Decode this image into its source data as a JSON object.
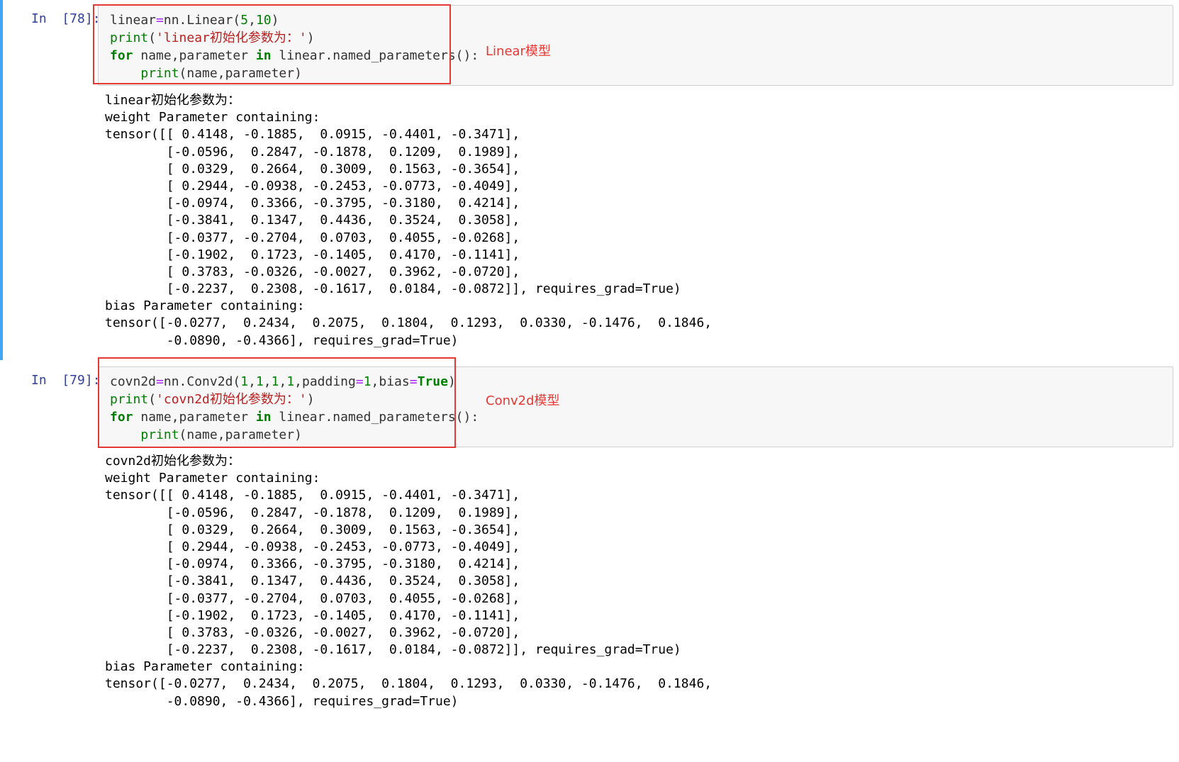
{
  "cells": [
    {
      "prompt": "In  [78]:",
      "code": {
        "line1": {
          "a": "linear",
          "eq": "=",
          "b": "nn.Linear(",
          "n1": "5",
          "comma": ",",
          "n2": "10",
          "c": ")"
        },
        "line2": {
          "fn": "print",
          "lp": "(",
          "str": "'linear初始化参数为：'",
          "rp": ")"
        },
        "line3": {
          "kw1": "for",
          "mid": " name,parameter ",
          "kw2": "in",
          "rest": " linear.named_parameters():"
        },
        "line4": {
          "indent": "    ",
          "fn": "print",
          "rest": "(name,parameter)"
        }
      },
      "annotation": "Linear模型",
      "output": [
        "linear初始化参数为：",
        "weight Parameter containing:",
        "tensor([[ 0.4148, -0.1885,  0.0915, -0.4401, -0.3471],",
        "        [-0.0596,  0.2847, -0.1878,  0.1209,  0.1989],",
        "        [ 0.0329,  0.2664,  0.3009,  0.1563, -0.3654],",
        "        [ 0.2944, -0.0938, -0.2453, -0.0773, -0.4049],",
        "        [-0.0974,  0.3366, -0.3795, -0.3180,  0.4214],",
        "        [-0.3841,  0.1347,  0.4436,  0.3524,  0.3058],",
        "        [-0.0377, -0.2704,  0.0703,  0.4055, -0.0268],",
        "        [-0.1902,  0.1723, -0.1405,  0.4170, -0.1141],",
        "        [ 0.3783, -0.0326, -0.0027,  0.3962, -0.0720],",
        "        [-0.2237,  0.2308, -0.1617,  0.0184, -0.0872]], requires_grad=True)",
        "bias Parameter containing:",
        "tensor([-0.0277,  0.2434,  0.2075,  0.1804,  0.1293,  0.0330, -0.1476,  0.1846,",
        "        -0.0890, -0.4366], requires_grad=True)"
      ]
    },
    {
      "prompt": "In  [79]:",
      "code": {
        "line1": {
          "a": "covn2d",
          "eq": "=",
          "b": "nn.Conv2d(",
          "n1": "1",
          "c1": ",",
          "n2": "1",
          "c2": ",",
          "n3": "1",
          "c3": ",",
          "n4": "1",
          "c4": ",padding",
          "eq2": "=",
          "n5": "1",
          "c5": ",bias",
          "eq3": "=",
          "kwTrue": "True",
          "c6": ")"
        },
        "line2": {
          "fn": "print",
          "lp": "(",
          "str": "'covn2d初始化参数为：'",
          "rp": ")"
        },
        "line3": {
          "kw1": "for",
          "mid": " name,parameter ",
          "kw2": "in",
          "rest": " linear.named_parameters():"
        },
        "line4": {
          "indent": "    ",
          "fn": "print",
          "rest": "(name,parameter)"
        }
      },
      "annotation": "Conv2d模型",
      "output": [
        "covn2d初始化参数为：",
        "weight Parameter containing:",
        "tensor([[ 0.4148, -0.1885,  0.0915, -0.4401, -0.3471],",
        "        [-0.0596,  0.2847, -0.1878,  0.1209,  0.1989],",
        "        [ 0.0329,  0.2664,  0.3009,  0.1563, -0.3654],",
        "        [ 0.2944, -0.0938, -0.2453, -0.0773, -0.4049],",
        "        [-0.0974,  0.3366, -0.3795, -0.3180,  0.4214],",
        "        [-0.3841,  0.1347,  0.4436,  0.3524,  0.3058],",
        "        [-0.0377, -0.2704,  0.0703,  0.4055, -0.0268],",
        "        [-0.1902,  0.1723, -0.1405,  0.4170, -0.1141],",
        "        [ 0.3783, -0.0326, -0.0027,  0.3962, -0.0720],",
        "        [-0.2237,  0.2308, -0.1617,  0.0184, -0.0872]], requires_grad=True)",
        "bias Parameter containing:",
        "tensor([-0.0277,  0.2434,  0.2075,  0.1804,  0.1293,  0.0330, -0.1476,  0.1846,",
        "        -0.0890, -0.4366], requires_grad=True)"
      ]
    }
  ],
  "colors": {
    "prompt": "#303f9f",
    "selected_bar": "#42a5f5",
    "highlight_box": "#e53935",
    "keyword": "#008000",
    "string": "#ba2121",
    "operator": "#aa22ff"
  }
}
